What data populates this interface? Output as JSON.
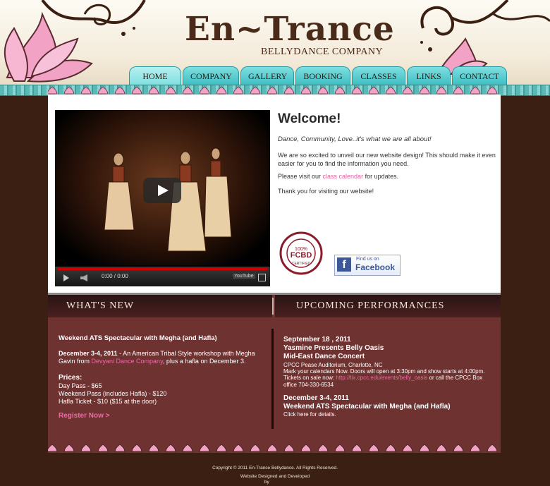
{
  "brand": {
    "title": "En~Trance",
    "subtitle": "BELLYDANCE COMPANY"
  },
  "nav": {
    "items": [
      {
        "label": "HOME",
        "active": true
      },
      {
        "label": "COMPANY",
        "active": false
      },
      {
        "label": "GALLERY",
        "active": false
      },
      {
        "label": "BOOKING",
        "active": false
      },
      {
        "label": "CLASSES",
        "active": false
      },
      {
        "label": "LINKS",
        "active": false
      },
      {
        "label": "CONTACT",
        "active": false
      }
    ]
  },
  "video": {
    "time": "0:00 / 0:00",
    "logo": "YouTube"
  },
  "welcome": {
    "title": "Welcome!",
    "tagline": "Dance, Community, Love..it's what we are all about!",
    "para1": "We are so excited to unveil our new website design! This should make it even easier for you to find the information you need.",
    "para2_prefix": "Please visit our ",
    "para2_link": "class calendar",
    "para2_suffix": " for updates.",
    "para3": "Thank you for visiting our website!"
  },
  "badge": {
    "text": "FCBD",
    "pct": "100%",
    "ring": "CERTIFIED"
  },
  "facebook": {
    "small": "Find us on",
    "big": "Facebook"
  },
  "whats_new": {
    "heading": "WHAT'S NEW",
    "title": "Weekend ATS Spectacular with Megha (and Hafla)",
    "date_bold": "December 3-4, 2011",
    "desc1": " - An American Tribal Style workshop with Megha Gavin from ",
    "desc_link": "Devyani Dance Company",
    "desc2": ", plus a hafla on December 3.",
    "prices_heading": "Prices:",
    "prices": [
      "Day Pass - $65",
      "Weekend Pass (includes Hafla) - $120",
      "Hafla Ticket - $10 ($15 at the door)"
    ],
    "register": "Register Now >"
  },
  "performances": {
    "heading": "UPCOMING PERFORMANCES",
    "e1_date": "September 18 , 2011",
    "e1_title": "Yasmine Presents Belly Oasis",
    "e1_sub": "Mid-East Dance Concert",
    "e1_venue": "CPCC Pease Auditorium, Charlotte, NC",
    "e1_note1": "Mark your calendars Now. Doors will open at 3:30pm and show starts at 4:00pm.",
    "e1_note2_prefix": "Tickets on sale now: ",
    "e1_note2_link": "http://tix.cpcc.edu/events/belly_oasis",
    "e1_note2_suffix": " or call the CPCC Box office 704-330-6534",
    "e2_date": "December 3-4, 2011",
    "e2_title": "Weekend ATS Spectacular with Megha (and Hafla)",
    "e2_link": "Click here for details."
  },
  "footer": {
    "copyright": "Copyright © 2011 En-Trance Bellydance. All Rights Reserved.",
    "credit1": "Website Designed and Developed",
    "credit2_prefix": "by "
  },
  "colors": {
    "teal": "#3cbdc3",
    "maroon": "#6e3230",
    "pink": "#f06aa8",
    "brown": "#3a1f12"
  }
}
